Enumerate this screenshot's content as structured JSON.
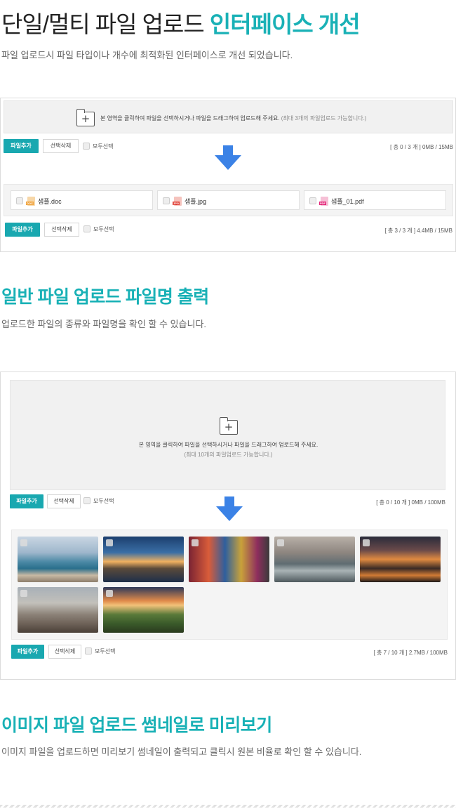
{
  "section1": {
    "title_main": "단일/멀티 파일 업로드 ",
    "title_accent": "인터페이스 개선",
    "subtitle": "파일 업로드시 파일 타입이나 개수에 최적화된 인터페이스로 개선 되었습니다.",
    "drop_text": "본 영역을 클릭하여 파일을 선택하시거나 파일을 드래그하여 업로드해 주세요.",
    "drop_hint": " (최대 3개의 파일업로드 가능합니다.)",
    "controls_top": {
      "add": "파일추가",
      "delete": "선택삭제",
      "select_all": "모두선택",
      "count": "[ 총 0 / 3 개 ] 0MB / 15MB"
    },
    "files": [
      {
        "name": "샘플.doc",
        "icon": "doc-file-icon",
        "badge": "DOC",
        "color": "#f0a23a"
      },
      {
        "name": "샘플.jpg",
        "icon": "jpg-file-icon",
        "badge": "JPG",
        "color": "#e0433a"
      },
      {
        "name": "샘플_01.pdf",
        "icon": "pdf-file-icon",
        "badge": "PDF",
        "color": "#e3287a"
      }
    ],
    "controls_bottom": {
      "add": "파일추가",
      "delete": "선택삭제",
      "select_all": "모두선택",
      "count": "[ 총 3 / 3 개 ] 4.4MB / 15MB"
    }
  },
  "section2": {
    "title": "일반 파일 업로드 파일명 출력",
    "subtitle": "업로드한 파일의 종류와 파일명을 확인 할 수 있습니다.",
    "drop_text": "본 영역을 클릭하여 파일을 선택하시거나 파일을 드래그하여 업로드해 주세요.",
    "drop_hint": "(최대 10개의 파일업로드 가능합니다.)",
    "controls_top": {
      "add": "파일추가",
      "delete": "선택삭제",
      "select_all": "모두선택",
      "count": "[ 총 0 / 10 개 ] 0MB / 100MB"
    },
    "thumbnails": [
      {
        "name": "coast-city-thumb",
        "bg": "linear-gradient(180deg,#c9d6e3 0%,#9fb7cc 35%,#4d8aa6 55%,#2a6f8c 70%,#c8b9a4 85%,#8d7e6c 100%)"
      },
      {
        "name": "night-palace-thumb",
        "bg": "linear-gradient(180deg,#1c3f6e 0%,#3a6ea5 35%,#f0b060 55%,#5a4a3a 70%,#1d2f4a 100%)"
      },
      {
        "name": "colorful-street-thumb",
        "bg": "linear-gradient(90deg,#7a2333 0%,#d95c3a 25%,#2e5f9e 45%,#c9a23a 65%,#8e2e5e 85%,#3a3a3a 100%)"
      },
      {
        "name": "river-city-thumb",
        "bg": "linear-gradient(180deg,#b8b0a8 0%,#8e8680 35%,#5f6c72 60%,#a9b3b5 75%,#4f5a5e 100%)"
      },
      {
        "name": "canal-sunset-thumb",
        "bg": "linear-gradient(180deg,#2a2b3a 0%,#6a4a4a 30%,#e08a40 50%,#3a2a25 70%,#d07a35 85%,#1e1a1a 100%)"
      },
      {
        "name": "cathedral-thumb",
        "bg": "linear-gradient(180deg,#a8b0b8 0%,#c2c0ba 35%,#8c8278 60%,#6e6258 80%,#4a4038 100%)"
      },
      {
        "name": "green-hills-thumb",
        "bg": "linear-gradient(180deg,#2e3a5a 0%,#e08a4a 30%,#f2c27a 40%,#5a7a3a 60%,#3a5a2a 80%,#2a3a1e 100%)"
      }
    ],
    "controls_bottom": {
      "add": "파일추가",
      "delete": "선택삭제",
      "select_all": "모두선택",
      "count": "[ 총 7 / 10 개 ] 2.7MB / 100MB"
    }
  },
  "section3": {
    "title": "이미지 파일 업로드 썸네일로 미리보기",
    "subtitle": "이미지 파일을 업로드하면 미리보기 썸네일이 출력되고 클릭시 원본 비율로 확인 할 수 있습니다."
  },
  "colors": {
    "accent": "#19b1b6",
    "button": "#19a8b0",
    "arrow": "#3b82e6"
  }
}
